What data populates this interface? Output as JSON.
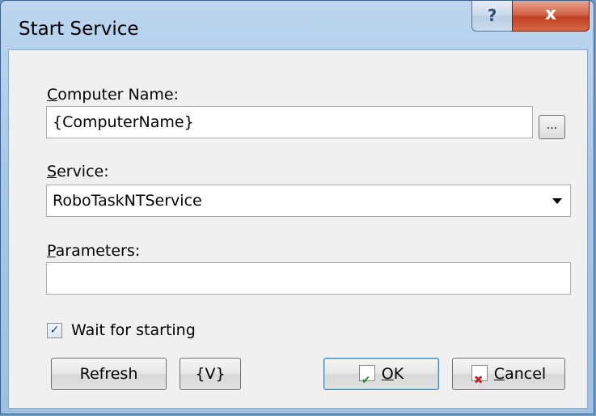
{
  "window": {
    "title": "Start Service",
    "help_glyph": "?",
    "close_glyph": "x"
  },
  "form": {
    "computer_name_label_u": "C",
    "computer_name_label_rest": "omputer Name:",
    "computer_name_value": "{ComputerName}",
    "browse_label": "...",
    "service_label_u": "S",
    "service_label_rest": "ervice:",
    "service_value": "RoboTaskNTService",
    "parameters_label_u": "P",
    "parameters_label_rest": "arameters:",
    "parameters_value": "",
    "wait_label": "Wait for starting",
    "wait_checked": true
  },
  "buttons": {
    "refresh": "Refresh",
    "variable": "{V}",
    "ok_u": "O",
    "ok_rest": "K",
    "cancel_u": "C",
    "cancel_rest": "ancel"
  }
}
